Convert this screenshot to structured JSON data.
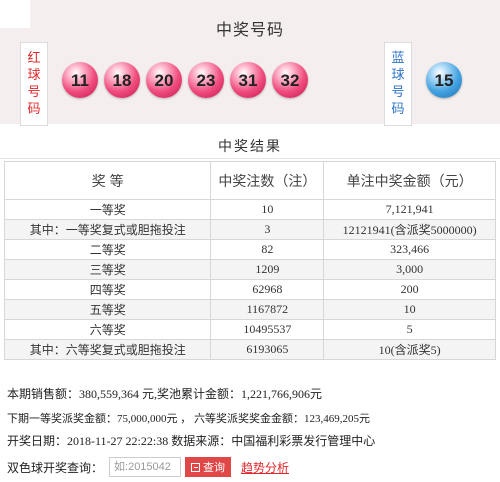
{
  "header": {
    "title": "中奖号码"
  },
  "numbers": {
    "red_label": [
      "红",
      "球",
      "号",
      "码"
    ],
    "blue_label": [
      "蓝",
      "球",
      "号",
      "码"
    ],
    "red_balls": [
      "11",
      "18",
      "20",
      "23",
      "31",
      "32"
    ],
    "blue_ball": "15",
    "colors": {
      "red_label": "#e1272b",
      "blue_label": "#2b73c7",
      "red_ball": "#f04f80",
      "blue_ball": "#45a4e3"
    }
  },
  "results": {
    "title": "中奖结果",
    "columns": [
      "奖 等",
      "中奖注数（注）",
      "单注中奖金额（元）"
    ],
    "rows": [
      [
        "一等奖",
        "10",
        "7,121,941"
      ],
      [
        "其中：一等奖复式或胆拖投注",
        "3",
        "12121941(含派奖5000000)"
      ],
      [
        "二等奖",
        "82",
        "323,466"
      ],
      [
        "三等奖",
        "1209",
        "3,000"
      ],
      [
        "四等奖",
        "62968",
        "200"
      ],
      [
        "五等奖",
        "1167872",
        "10"
      ],
      [
        "六等奖",
        "10495537",
        "5"
      ],
      [
        "其中：六等奖复式或胆拖投注",
        "6193065",
        "10(含派奖5)"
      ]
    ]
  },
  "info": {
    "sales": "本期销售额：380,559,364 元,奖池累计金额：1,221,766,906元",
    "next_bonus": "下期一等奖派奖金额：75,000,000元 ， 六等奖派奖奖金金额：123,469,205元",
    "draw": "开奖日期：2018-11-27 22:22:38 数据来源：中国福利彩票发行管理中心"
  },
  "query": {
    "label": "双色球开奖查询：",
    "placeholder": "如:2015042",
    "button_label": "查询",
    "trend_label": "趋势分析",
    "accent_color": "#e24747"
  }
}
